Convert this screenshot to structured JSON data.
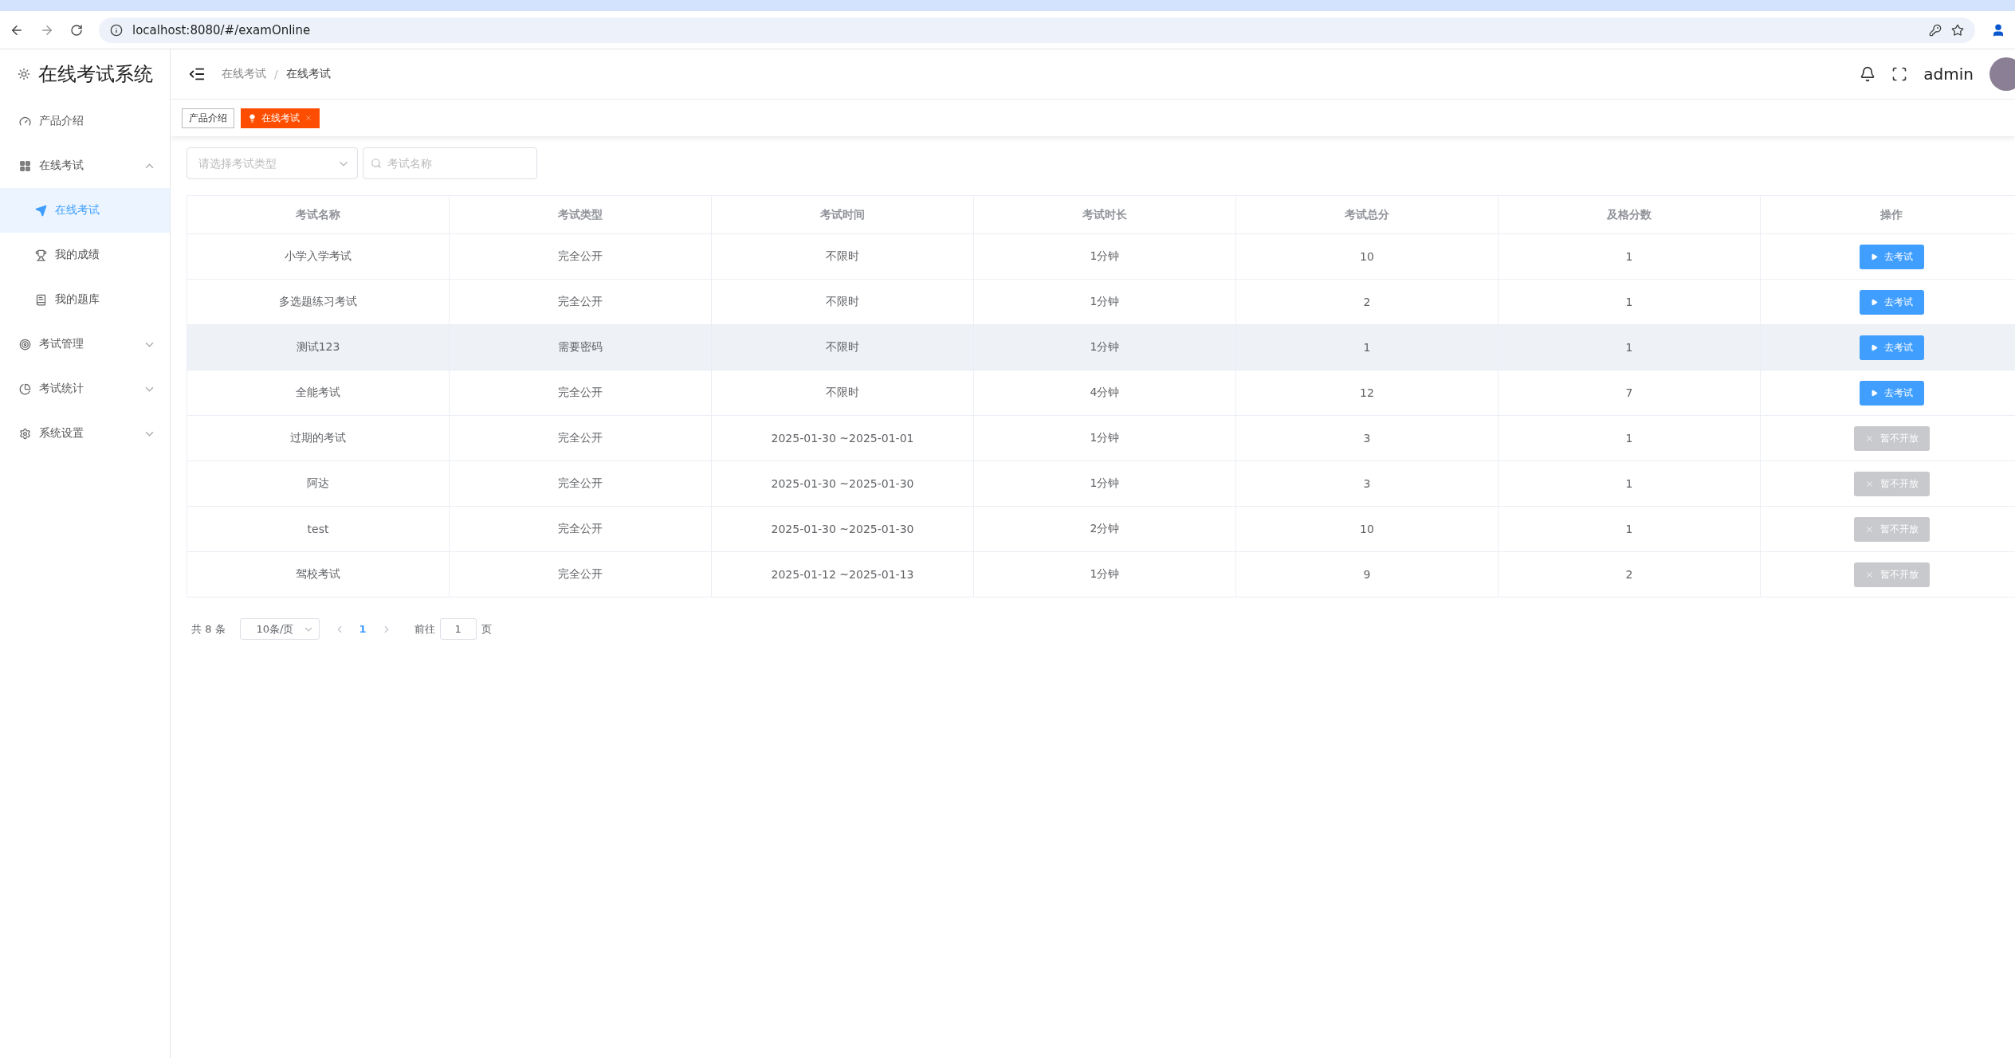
{
  "browser": {
    "url": "localhost:8080/#/examOnline"
  },
  "sidebar": {
    "title": "在线考试系统",
    "items": [
      {
        "label": "产品介绍",
        "selected": false
      },
      {
        "label": "在线考试",
        "expanded": true,
        "selected": false,
        "children": [
          {
            "label": "在线考试",
            "selected": true
          },
          {
            "label": "我的成绩",
            "selected": false
          },
          {
            "label": "我的题库",
            "selected": false
          }
        ]
      },
      {
        "label": "考试管理",
        "expanded": false,
        "selected": false
      },
      {
        "label": "考试统计",
        "expanded": false,
        "selected": false
      },
      {
        "label": "系统设置",
        "expanded": false,
        "selected": false
      }
    ]
  },
  "header": {
    "breadcrumb": [
      "在线考试",
      "在线考试"
    ],
    "separator": "/",
    "user": "admin"
  },
  "tags": [
    {
      "label": "产品介绍",
      "selected": false
    },
    {
      "label": "在线考试",
      "selected": true
    }
  ],
  "filters": {
    "type_placeholder": "请选择考试类型",
    "name_placeholder": "考试名称"
  },
  "table": {
    "columns": [
      "考试名称",
      "考试类型",
      "考试时间",
      "考试时长",
      "考试总分",
      "及格分数",
      "操作"
    ],
    "rows": [
      {
        "cells": [
          "小学入学考试",
          "完全公开",
          "不限时",
          "1分钟",
          "10",
          "1"
        ],
        "action": "去考试",
        "disabled": false,
        "hovered": false
      },
      {
        "cells": [
          "多选题练习考试",
          "完全公开",
          "不限时",
          "1分钟",
          "2",
          "1"
        ],
        "action": "去考试",
        "disabled": false,
        "hovered": false
      },
      {
        "cells": [
          "测试123",
          "需要密码",
          "不限时",
          "1分钟",
          "1",
          "1"
        ],
        "action": "去考试",
        "disabled": false,
        "hovered": true
      },
      {
        "cells": [
          "全能考试",
          "完全公开",
          "不限时",
          "4分钟",
          "12",
          "7"
        ],
        "action": "去考试",
        "disabled": false,
        "hovered": false
      },
      {
        "cells": [
          "过期的考试",
          "完全公开",
          "2025-01-30 ~2025-01-01",
          "1分钟",
          "3",
          "1"
        ],
        "action": "暂不开放",
        "disabled": true,
        "hovered": false
      },
      {
        "cells": [
          "阿达",
          "完全公开",
          "2025-01-30 ~2025-01-30",
          "1分钟",
          "3",
          "1"
        ],
        "action": "暂不开放",
        "disabled": true,
        "hovered": false
      },
      {
        "cells": [
          "test",
          "完全公开",
          "2025-01-30 ~2025-01-30",
          "2分钟",
          "10",
          "1"
        ],
        "action": "暂不开放",
        "disabled": true,
        "hovered": false
      },
      {
        "cells": [
          "驾校考试",
          "完全公开",
          "2025-01-12 ~2025-01-13",
          "1分钟",
          "9",
          "2"
        ],
        "action": "暂不开放",
        "disabled": true,
        "hovered": false
      }
    ]
  },
  "pagination": {
    "total": "共 8 条",
    "page_size": "10条/页",
    "pages": [
      {
        "label": "1",
        "selected": true
      }
    ],
    "goto_label": "前往",
    "goto_value": "1",
    "goto_suffix": "页"
  }
}
